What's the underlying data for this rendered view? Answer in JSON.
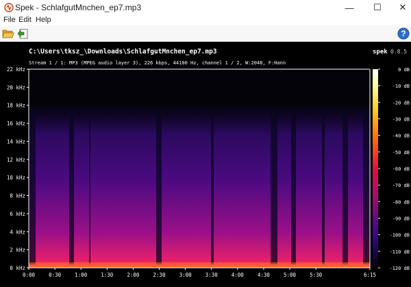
{
  "window": {
    "title": "Spek - SchlafgutMnchen_ep7.mp3",
    "minimize_glyph": "—",
    "maximize_glyph": "☐",
    "close_glyph": "✕",
    "app_icon": "spek-app-icon"
  },
  "menu": {
    "items": [
      "File",
      "Edit",
      "Help"
    ]
  },
  "toolbar": {
    "open_icon": "folder-open-icon",
    "save_icon": "save-png-icon",
    "help_icon": "help-icon"
  },
  "spectrogram": {
    "file_path": "C:\\Users\\tksz_\\Downloads\\SchlafgutMnchen_ep7.mp3",
    "stream_info": "Stream 1 / 1: MP3 (MPEG audio layer 3), 226 kbps, 44100 Hz, channel 1 / 2, W:2048, F:Hann",
    "app_name": "spek",
    "app_version": "0.8.5",
    "freq_ticks": [
      "22 kHz",
      "20 kHz",
      "18 kHz",
      "16 kHz",
      "14 kHz",
      "12 kHz",
      "10 kHz",
      "8 kHz",
      "6 kHz",
      "4 kHz",
      "2 kHz",
      "0 kHz"
    ],
    "time_ticks": [
      "0:00",
      "0:30",
      "1:00",
      "1:30",
      "2:00",
      "2:30",
      "3:00",
      "3:30",
      "4:00",
      "4:30",
      "5:00",
      "5:30",
      "6:15"
    ],
    "db_ticks": [
      "0 dB",
      "-10 dB",
      "-20 dB",
      "-30 dB",
      "-40 dB",
      "-50 dB",
      "-60 dB",
      "-70 dB",
      "-80 dB",
      "-90 dB",
      "-100 dB",
      "-110 dB",
      "-120 dB"
    ],
    "colors": {
      "background": "#000000",
      "low_band": "#d8205a",
      "mid_band": "#6a0a8a",
      "high_band": "#2a0a6a",
      "cutoff": "#000010"
    },
    "cutoff_khz": 18
  }
}
